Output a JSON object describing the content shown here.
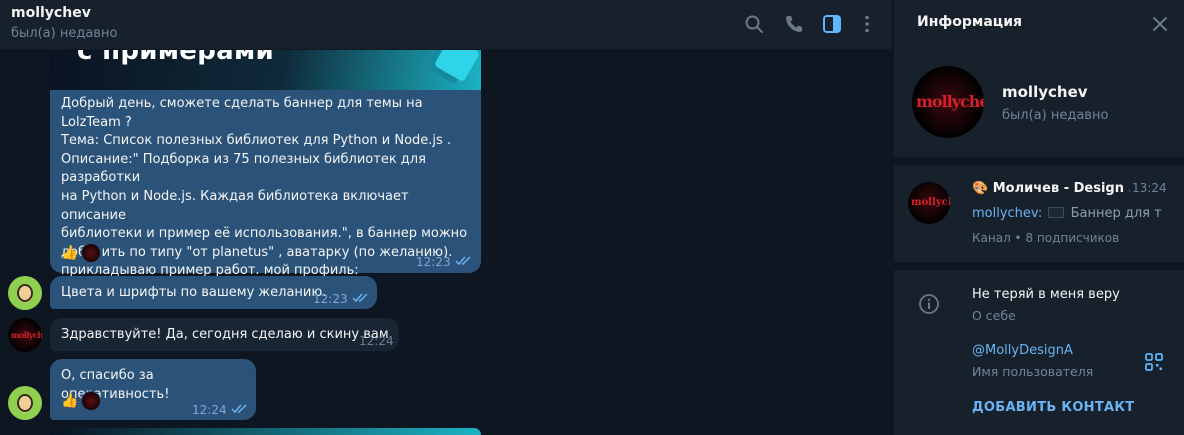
{
  "chat": {
    "title": "mollychev",
    "status": "был(а) недавно",
    "icons": {
      "search": "search-icon",
      "call": "phone-icon",
      "panel": "sidebar-toggle-icon",
      "menu": "more-vertical-icon"
    }
  },
  "messages": {
    "banner_text": "с примерами",
    "m1_text": "Добрый день, сможете сделать баннер для темы на LolzTeam ?\nТема: Список полезных библиотек для Python и Node.js .\nОписание:\" Подборка из 75 полезных библиотек для разработки\nна Python и Node.js. Каждая библиотека включает описание\nбиблиотеки и пример её использования.\", в баннер можно\nдобавить по типу \"от planetus\" , аватарку (по желанию).\nприкладываю пример работ. мой профиль:",
    "m1_link": "https://lolz.live/planetus/",
    "m1_reaction": "👍",
    "m1_time": "12:23",
    "m2_text": "Цвета и шрифты по вашему желанию.",
    "m2_time": "12:23",
    "m3_text": "Здравствуйте! Да, сегодня сделаю и скину вам",
    "m3_time": "12:24",
    "m4_text": "О, спасибо за оперативность!",
    "m4_reaction": "👍",
    "m4_time": "12:24",
    "avatar_logo": "mollychev"
  },
  "info": {
    "title": "Информация",
    "name": "mollychev",
    "status": "был(а) недавно",
    "avatar_logo": "mollychev",
    "channel": {
      "emoji": "🎨",
      "name": "Моличев - Design ...",
      "time": "13:24",
      "sender": "mollychev:",
      "preview": "Баннер для те...",
      "meta": "Канал • 8 подписчиков"
    },
    "bio": "Не теряй в меня веру",
    "bio_label": "О себе",
    "username": "@MollyDesignA",
    "username_label": "Имя пользователя",
    "add_contact": "ДОБАВИТЬ КОНТАКТ"
  }
}
